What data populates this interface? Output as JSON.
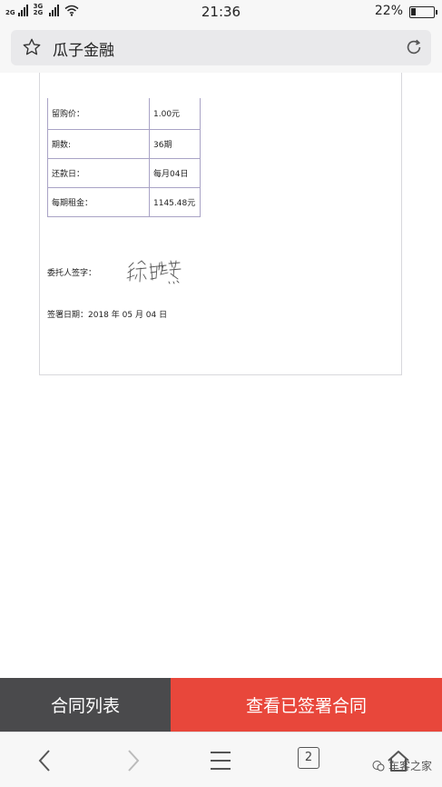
{
  "status_bar": {
    "signal_1_label": "2G",
    "signal_2_label": "3G 2G",
    "time": "21:36",
    "battery_percent": "22%",
    "battery_level": 0.22
  },
  "browser": {
    "page_title": "瓜子金融",
    "tab_count": "2"
  },
  "document": {
    "rows": [
      {
        "label": "留购价：",
        "value": "1.00元"
      },
      {
        "label": "期数:",
        "value": "36期"
      },
      {
        "label": "还款日：",
        "value": "每月04日"
      },
      {
        "label": "每期租金：",
        "value": "1145.48元"
      }
    ],
    "signer_label": "委托人签字：",
    "signature_text": "徐晓燕",
    "sign_date": "签署日期：2018 年 05 月 04 日"
  },
  "actions": {
    "contract_list": "合同列表",
    "view_signed": "查看已签署合同"
  },
  "watermark": "车客之家",
  "colors": {
    "dark_button": "#4a4a4c",
    "accent_red": "#e8473b",
    "table_border": "#a9a3c6"
  },
  "icons": [
    "star-icon",
    "refresh-icon",
    "back-icon",
    "forward-icon",
    "menu-icon",
    "home-icon",
    "wechat-icon"
  ]
}
